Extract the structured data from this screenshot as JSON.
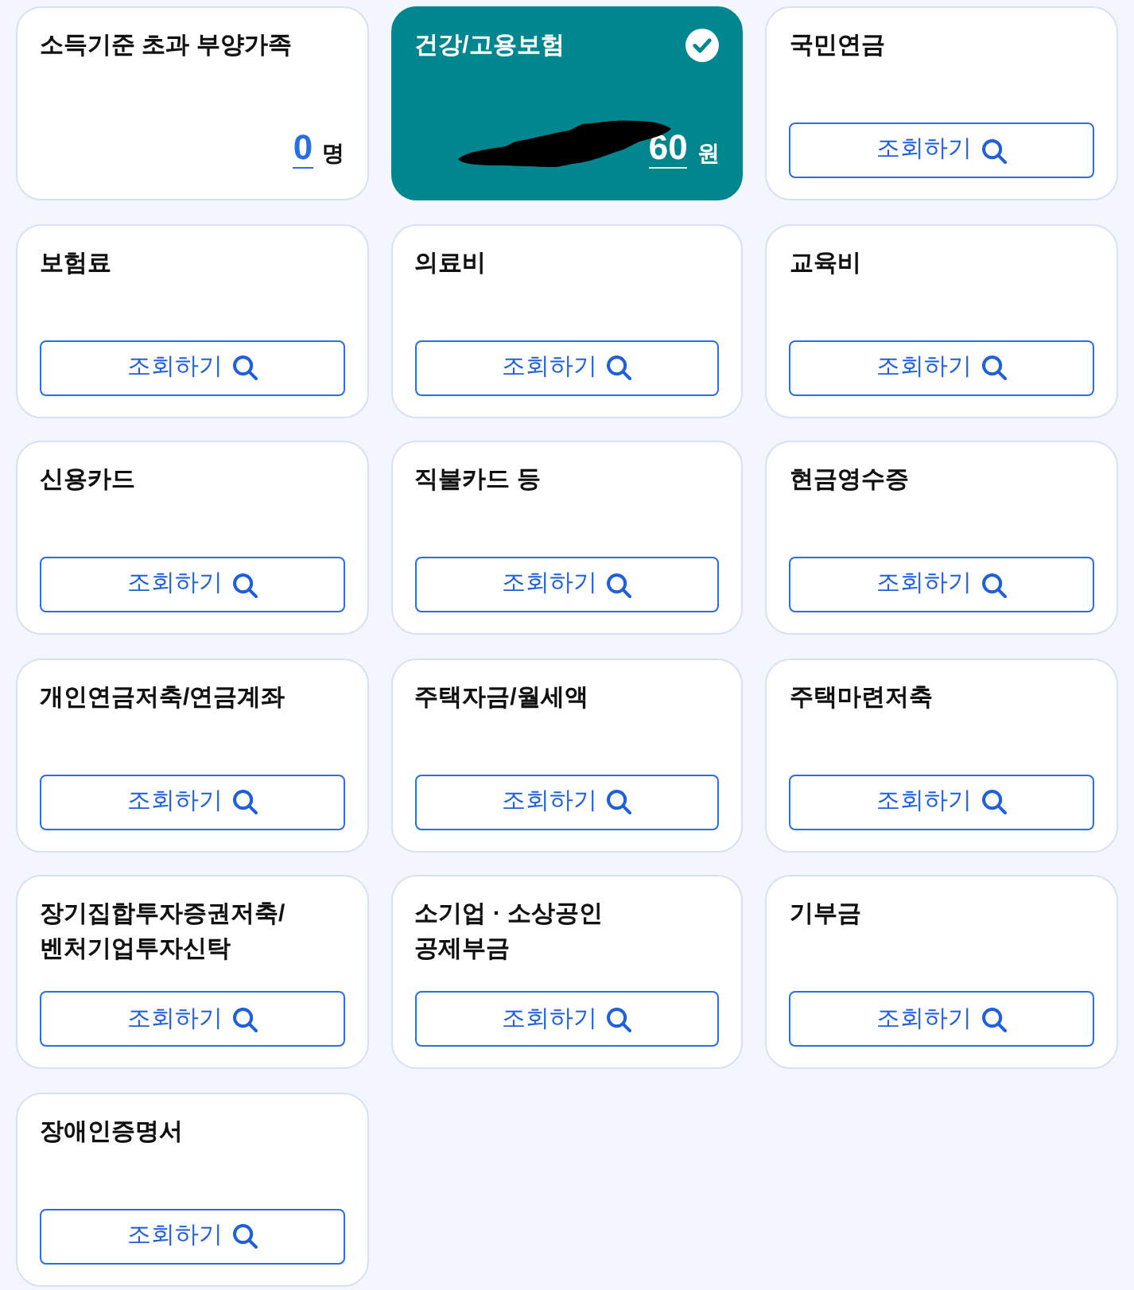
{
  "cards": [
    {
      "kind": "count",
      "title": "소득기준 초과 부양가족",
      "selected": false,
      "value": "0",
      "unit": "명"
    },
    {
      "kind": "amount",
      "title": "건강/고용보험",
      "selected": true,
      "value": "60",
      "unit": "원",
      "redacted": true
    },
    {
      "kind": "lookup",
      "title": "국민연금",
      "selected": false,
      "button": "조회하기"
    },
    {
      "kind": "lookup",
      "title": "보험료",
      "selected": false,
      "button": "조회하기"
    },
    {
      "kind": "lookup",
      "title": "의료비",
      "selected": false,
      "button": "조회하기"
    },
    {
      "kind": "lookup",
      "title": "교육비",
      "selected": false,
      "button": "조회하기"
    },
    {
      "kind": "lookup",
      "title": "신용카드",
      "selected": false,
      "button": "조회하기"
    },
    {
      "kind": "lookup",
      "title": "직불카드 등",
      "selected": false,
      "button": "조회하기"
    },
    {
      "kind": "lookup",
      "title": "현금영수증",
      "selected": false,
      "button": "조회하기"
    },
    {
      "kind": "lookup",
      "title": "개인연금저축/연금계좌",
      "selected": false,
      "button": "조회하기"
    },
    {
      "kind": "lookup",
      "title": "주택자금/월세액",
      "selected": false,
      "button": "조회하기"
    },
    {
      "kind": "lookup",
      "title": "주택마련저축",
      "selected": false,
      "button": "조회하기"
    },
    {
      "kind": "lookup",
      "title": "장기집합투자증권저축/\n벤처기업투자신탁",
      "selected": false,
      "button": "조회하기"
    },
    {
      "kind": "lookup",
      "title": "소기업 · 소상공인\n공제부금",
      "selected": false,
      "button": "조회하기"
    },
    {
      "kind": "lookup",
      "title": "기부금",
      "selected": false,
      "button": "조회하기"
    },
    {
      "kind": "lookup",
      "title": "장애인증명서",
      "selected": false,
      "button": "조회하기"
    }
  ]
}
